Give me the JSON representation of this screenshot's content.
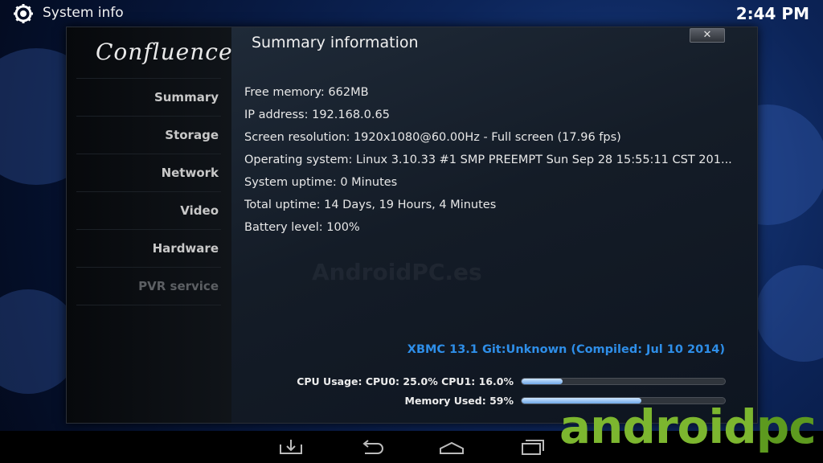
{
  "window": {
    "title": "System info",
    "clock": "2:44 PM"
  },
  "sidebar": {
    "logo": "Confluence",
    "items": [
      {
        "label": "Summary"
      },
      {
        "label": "Storage"
      },
      {
        "label": "Network"
      },
      {
        "label": "Video"
      },
      {
        "label": "Hardware"
      },
      {
        "label": "PVR service"
      }
    ]
  },
  "content": {
    "title": "Summary information",
    "close_label": "✕",
    "info": [
      "Free memory: 662MB",
      "IP address: 192.168.0.65",
      "Screen resolution: 1920x1080@60.00Hz - Full screen (17.96 fps)",
      "Operating system: Linux 3.10.33 #1 SMP PREEMPT Sun Sep 28 15:55:11 CST 201...",
      "System uptime: 0 Minutes",
      "Total uptime: 14 Days, 19 Hours, 4 Minutes",
      "Battery level: 100%"
    ],
    "watermark": "AndroidPC.es",
    "version": "XBMC 13.1 Git:Unknown (Compiled: Jul 10 2014)",
    "cpu": {
      "label": "CPU Usage: CPU0: 25.0% CPU1: 16.0%",
      "level": 0.2
    },
    "memory": {
      "label": "Memory Used: 59%",
      "level": 0.59
    }
  },
  "navbar": {
    "icons": [
      "download-icon",
      "back-icon",
      "home-icon",
      "recent-apps-icon"
    ]
  },
  "branding": {
    "part1": "android",
    "part2": "pc"
  },
  "colors": {
    "accent": "#2e8ee8",
    "brand": "#7cb62f"
  }
}
